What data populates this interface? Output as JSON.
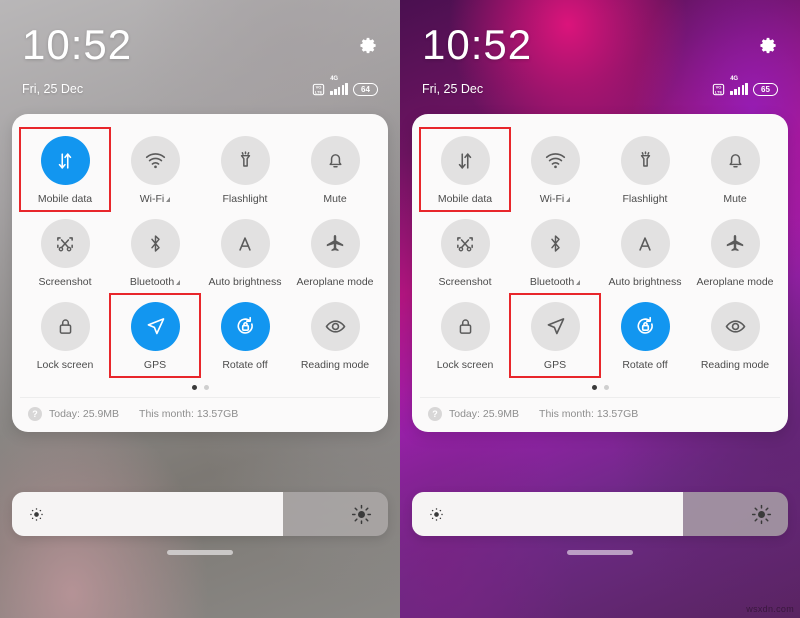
{
  "panels": [
    {
      "id": "left",
      "theme": "gray",
      "status": {
        "time": "10:52",
        "date": "Fri, 25 Dec",
        "network_label": "4G",
        "battery": "64",
        "gear_icon": "gear-icon",
        "sim_icon": "dual-sim-icon",
        "signal_icon": "signal-bars-icon"
      },
      "tiles": [
        {
          "label": "Mobile data",
          "icon": "mobile-data-icon",
          "active": true,
          "highlight": true,
          "has_signal_triangle": false
        },
        {
          "label": "Wi-Fi",
          "icon": "wifi-icon",
          "active": false,
          "highlight": false,
          "has_signal_triangle": true
        },
        {
          "label": "Flashlight",
          "icon": "flashlight-icon",
          "active": false,
          "highlight": false,
          "has_signal_triangle": false
        },
        {
          "label": "Mute",
          "icon": "bell-icon",
          "active": false,
          "highlight": false,
          "has_signal_triangle": false
        },
        {
          "label": "Screenshot",
          "icon": "screenshot-scissors-icon",
          "active": false,
          "highlight": false,
          "has_signal_triangle": false
        },
        {
          "label": "Bluetooth",
          "icon": "bluetooth-icon",
          "active": false,
          "highlight": false,
          "has_signal_triangle": true
        },
        {
          "label": "Auto brightness",
          "icon": "auto-brightness-a-icon",
          "active": false,
          "highlight": false,
          "has_signal_triangle": false
        },
        {
          "label": "Aeroplane mode",
          "icon": "airplane-icon",
          "active": false,
          "highlight": false,
          "has_signal_triangle": false
        },
        {
          "label": "Lock screen",
          "icon": "lock-icon",
          "active": false,
          "highlight": false,
          "has_signal_triangle": false
        },
        {
          "label": "GPS",
          "icon": "gps-navigation-icon",
          "active": true,
          "highlight": true,
          "has_signal_triangle": false
        },
        {
          "label": "Rotate off",
          "icon": "rotate-lock-icon",
          "active": true,
          "highlight": false,
          "has_signal_triangle": false
        },
        {
          "label": "Reading mode",
          "icon": "eye-icon",
          "active": false,
          "highlight": false,
          "has_signal_triangle": false
        }
      ],
      "pager": {
        "count": 2,
        "active_index": 0
      },
      "usage": {
        "help_badge": "?",
        "today": "Today: 25.9MB",
        "month": "This month: 13.57GB"
      },
      "brightness": {
        "percent": 72,
        "low_icon": "brightness-low-icon",
        "high_icon": "brightness-high-icon"
      }
    },
    {
      "id": "right",
      "theme": "purple",
      "status": {
        "time": "10:52",
        "date": "Fri, 25 Dec",
        "network_label": "4G",
        "battery": "65",
        "gear_icon": "gear-icon",
        "sim_icon": "dual-sim-icon",
        "signal_icon": "signal-bars-icon"
      },
      "tiles": [
        {
          "label": "Mobile data",
          "icon": "mobile-data-icon",
          "active": false,
          "highlight": true,
          "has_signal_triangle": false
        },
        {
          "label": "Wi-Fi",
          "icon": "wifi-icon",
          "active": false,
          "highlight": false,
          "has_signal_triangle": true
        },
        {
          "label": "Flashlight",
          "icon": "flashlight-icon",
          "active": false,
          "highlight": false,
          "has_signal_triangle": false
        },
        {
          "label": "Mute",
          "icon": "bell-icon",
          "active": false,
          "highlight": false,
          "has_signal_triangle": false
        },
        {
          "label": "Screenshot",
          "icon": "screenshot-scissors-icon",
          "active": false,
          "highlight": false,
          "has_signal_triangle": false
        },
        {
          "label": "Bluetooth",
          "icon": "bluetooth-icon",
          "active": false,
          "highlight": false,
          "has_signal_triangle": true
        },
        {
          "label": "Auto brightness",
          "icon": "auto-brightness-a-icon",
          "active": false,
          "highlight": false,
          "has_signal_triangle": false
        },
        {
          "label": "Aeroplane mode",
          "icon": "airplane-icon",
          "active": false,
          "highlight": false,
          "has_signal_triangle": false
        },
        {
          "label": "Lock screen",
          "icon": "lock-icon",
          "active": false,
          "highlight": false,
          "has_signal_triangle": false
        },
        {
          "label": "GPS",
          "icon": "gps-navigation-icon",
          "active": false,
          "highlight": true,
          "has_signal_triangle": false
        },
        {
          "label": "Rotate off",
          "icon": "rotate-lock-icon",
          "active": true,
          "highlight": false,
          "has_signal_triangle": false
        },
        {
          "label": "Reading mode",
          "icon": "eye-icon",
          "active": false,
          "highlight": false,
          "has_signal_triangle": false
        }
      ],
      "pager": {
        "count": 2,
        "active_index": 0
      },
      "usage": {
        "help_badge": "?",
        "today": "Today: 25.9MB",
        "month": "This month: 13.57GB"
      },
      "brightness": {
        "percent": 72,
        "low_icon": "brightness-low-icon",
        "high_icon": "brightness-high-icon"
      },
      "watermark": "wsxdn.com"
    }
  ],
  "colors": {
    "accent_on": "#1296f0",
    "highlight_box": "#e8262b",
    "tile_off": "#e2e1e1",
    "panel_bg": "#fbfafa"
  }
}
